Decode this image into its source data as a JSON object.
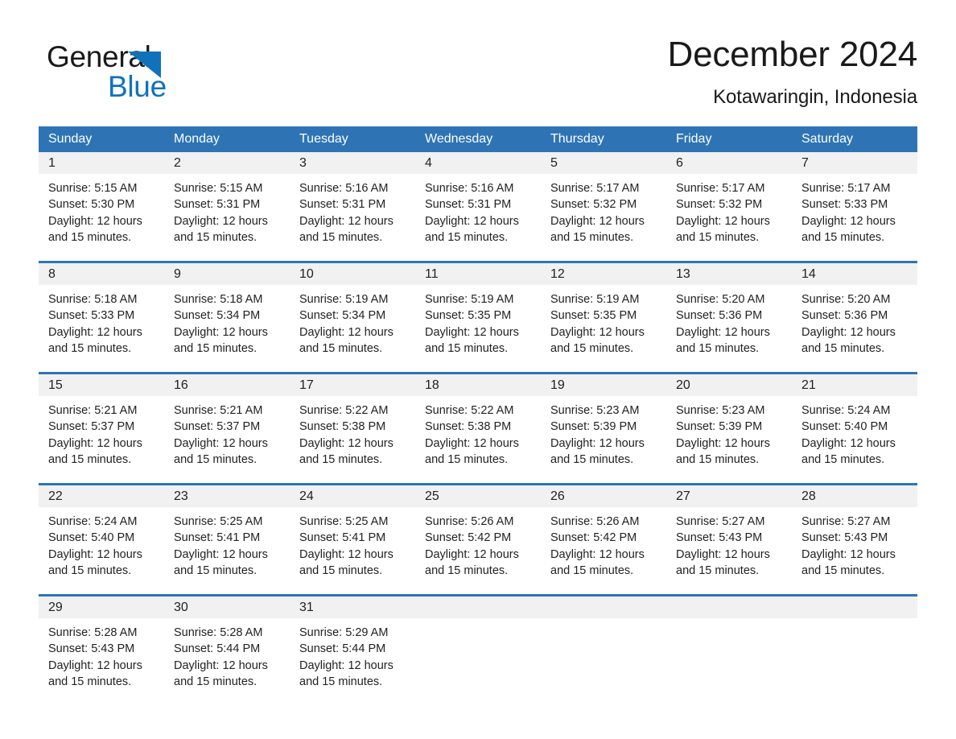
{
  "brand": {
    "name_part1": "General",
    "name_part2": "Blue",
    "accent_color": "#1072bb",
    "triangle_icon": "triangle-icon"
  },
  "header": {
    "month_title": "December 2024",
    "location": "Kotawaringin, Indonesia"
  },
  "calendar": {
    "header_color": "#2e74b5",
    "weekday_headers": [
      "Sunday",
      "Monday",
      "Tuesday",
      "Wednesday",
      "Thursday",
      "Friday",
      "Saturday"
    ],
    "weeks": [
      {
        "days": [
          {
            "date": "1",
            "sunrise": "Sunrise: 5:15 AM",
            "sunset": "Sunset: 5:30 PM",
            "daylight": "Daylight: 12 hours and 15 minutes."
          },
          {
            "date": "2",
            "sunrise": "Sunrise: 5:15 AM",
            "sunset": "Sunset: 5:31 PM",
            "daylight": "Daylight: 12 hours and 15 minutes."
          },
          {
            "date": "3",
            "sunrise": "Sunrise: 5:16 AM",
            "sunset": "Sunset: 5:31 PM",
            "daylight": "Daylight: 12 hours and 15 minutes."
          },
          {
            "date": "4",
            "sunrise": "Sunrise: 5:16 AM",
            "sunset": "Sunset: 5:31 PM",
            "daylight": "Daylight: 12 hours and 15 minutes."
          },
          {
            "date": "5",
            "sunrise": "Sunrise: 5:17 AM",
            "sunset": "Sunset: 5:32 PM",
            "daylight": "Daylight: 12 hours and 15 minutes."
          },
          {
            "date": "6",
            "sunrise": "Sunrise: 5:17 AM",
            "sunset": "Sunset: 5:32 PM",
            "daylight": "Daylight: 12 hours and 15 minutes."
          },
          {
            "date": "7",
            "sunrise": "Sunrise: 5:17 AM",
            "sunset": "Sunset: 5:33 PM",
            "daylight": "Daylight: 12 hours and 15 minutes."
          }
        ]
      },
      {
        "days": [
          {
            "date": "8",
            "sunrise": "Sunrise: 5:18 AM",
            "sunset": "Sunset: 5:33 PM",
            "daylight": "Daylight: 12 hours and 15 minutes."
          },
          {
            "date": "9",
            "sunrise": "Sunrise: 5:18 AM",
            "sunset": "Sunset: 5:34 PM",
            "daylight": "Daylight: 12 hours and 15 minutes."
          },
          {
            "date": "10",
            "sunrise": "Sunrise: 5:19 AM",
            "sunset": "Sunset: 5:34 PM",
            "daylight": "Daylight: 12 hours and 15 minutes."
          },
          {
            "date": "11",
            "sunrise": "Sunrise: 5:19 AM",
            "sunset": "Sunset: 5:35 PM",
            "daylight": "Daylight: 12 hours and 15 minutes."
          },
          {
            "date": "12",
            "sunrise": "Sunrise: 5:19 AM",
            "sunset": "Sunset: 5:35 PM",
            "daylight": "Daylight: 12 hours and 15 minutes."
          },
          {
            "date": "13",
            "sunrise": "Sunrise: 5:20 AM",
            "sunset": "Sunset: 5:36 PM",
            "daylight": "Daylight: 12 hours and 15 minutes."
          },
          {
            "date": "14",
            "sunrise": "Sunrise: 5:20 AM",
            "sunset": "Sunset: 5:36 PM",
            "daylight": "Daylight: 12 hours and 15 minutes."
          }
        ]
      },
      {
        "days": [
          {
            "date": "15",
            "sunrise": "Sunrise: 5:21 AM",
            "sunset": "Sunset: 5:37 PM",
            "daylight": "Daylight: 12 hours and 15 minutes."
          },
          {
            "date": "16",
            "sunrise": "Sunrise: 5:21 AM",
            "sunset": "Sunset: 5:37 PM",
            "daylight": "Daylight: 12 hours and 15 minutes."
          },
          {
            "date": "17",
            "sunrise": "Sunrise: 5:22 AM",
            "sunset": "Sunset: 5:38 PM",
            "daylight": "Daylight: 12 hours and 15 minutes."
          },
          {
            "date": "18",
            "sunrise": "Sunrise: 5:22 AM",
            "sunset": "Sunset: 5:38 PM",
            "daylight": "Daylight: 12 hours and 15 minutes."
          },
          {
            "date": "19",
            "sunrise": "Sunrise: 5:23 AM",
            "sunset": "Sunset: 5:39 PM",
            "daylight": "Daylight: 12 hours and 15 minutes."
          },
          {
            "date": "20",
            "sunrise": "Sunrise: 5:23 AM",
            "sunset": "Sunset: 5:39 PM",
            "daylight": "Daylight: 12 hours and 15 minutes."
          },
          {
            "date": "21",
            "sunrise": "Sunrise: 5:24 AM",
            "sunset": "Sunset: 5:40 PM",
            "daylight": "Daylight: 12 hours and 15 minutes."
          }
        ]
      },
      {
        "days": [
          {
            "date": "22",
            "sunrise": "Sunrise: 5:24 AM",
            "sunset": "Sunset: 5:40 PM",
            "daylight": "Daylight: 12 hours and 15 minutes."
          },
          {
            "date": "23",
            "sunrise": "Sunrise: 5:25 AM",
            "sunset": "Sunset: 5:41 PM",
            "daylight": "Daylight: 12 hours and 15 minutes."
          },
          {
            "date": "24",
            "sunrise": "Sunrise: 5:25 AM",
            "sunset": "Sunset: 5:41 PM",
            "daylight": "Daylight: 12 hours and 15 minutes."
          },
          {
            "date": "25",
            "sunrise": "Sunrise: 5:26 AM",
            "sunset": "Sunset: 5:42 PM",
            "daylight": "Daylight: 12 hours and 15 minutes."
          },
          {
            "date": "26",
            "sunrise": "Sunrise: 5:26 AM",
            "sunset": "Sunset: 5:42 PM",
            "daylight": "Daylight: 12 hours and 15 minutes."
          },
          {
            "date": "27",
            "sunrise": "Sunrise: 5:27 AM",
            "sunset": "Sunset: 5:43 PM",
            "daylight": "Daylight: 12 hours and 15 minutes."
          },
          {
            "date": "28",
            "sunrise": "Sunrise: 5:27 AM",
            "sunset": "Sunset: 5:43 PM",
            "daylight": "Daylight: 12 hours and 15 minutes."
          }
        ]
      },
      {
        "days": [
          {
            "date": "29",
            "sunrise": "Sunrise: 5:28 AM",
            "sunset": "Sunset: 5:43 PM",
            "daylight": "Daylight: 12 hours and 15 minutes."
          },
          {
            "date": "30",
            "sunrise": "Sunrise: 5:28 AM",
            "sunset": "Sunset: 5:44 PM",
            "daylight": "Daylight: 12 hours and 15 minutes."
          },
          {
            "date": "31",
            "sunrise": "Sunrise: 5:29 AM",
            "sunset": "Sunset: 5:44 PM",
            "daylight": "Daylight: 12 hours and 15 minutes."
          },
          {
            "date": "",
            "sunrise": "",
            "sunset": "",
            "daylight": ""
          },
          {
            "date": "",
            "sunrise": "",
            "sunset": "",
            "daylight": ""
          },
          {
            "date": "",
            "sunrise": "",
            "sunset": "",
            "daylight": ""
          },
          {
            "date": "",
            "sunrise": "",
            "sunset": "",
            "daylight": ""
          }
        ]
      }
    ]
  }
}
